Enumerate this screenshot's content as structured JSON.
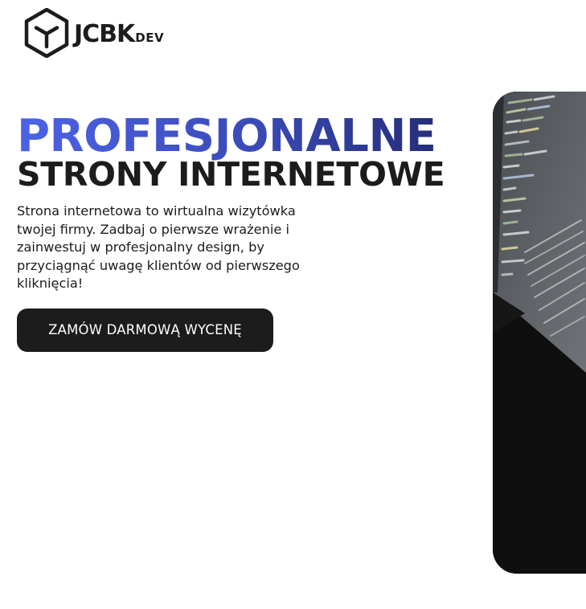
{
  "brand": {
    "name": "JCBK",
    "suffix": "DEV"
  },
  "hero": {
    "title_line_1": "PROFESJONALNE",
    "title_line_2": "STRONY INTERNETOWE",
    "description": "Strona internetowa to wirtualna wizytówka twojej firmy. Zadbaj o pierwsze wrażenie i zainwestuj w profesjonalny design, by przyciągnąć uwagę klientów od pierwszego kliknięcia!",
    "cta_label": "ZAMÓW DARMOWĄ WYCENĘ",
    "image_subject": "laptop-with-code-editor"
  },
  "colors": {
    "text_dark": "#1c1c1c",
    "gradient_start": "#4d63e8",
    "gradient_end": "#20276a",
    "button_bg": "#1c1c1c",
    "button_text": "#ffffff",
    "background": "#ffffff"
  }
}
